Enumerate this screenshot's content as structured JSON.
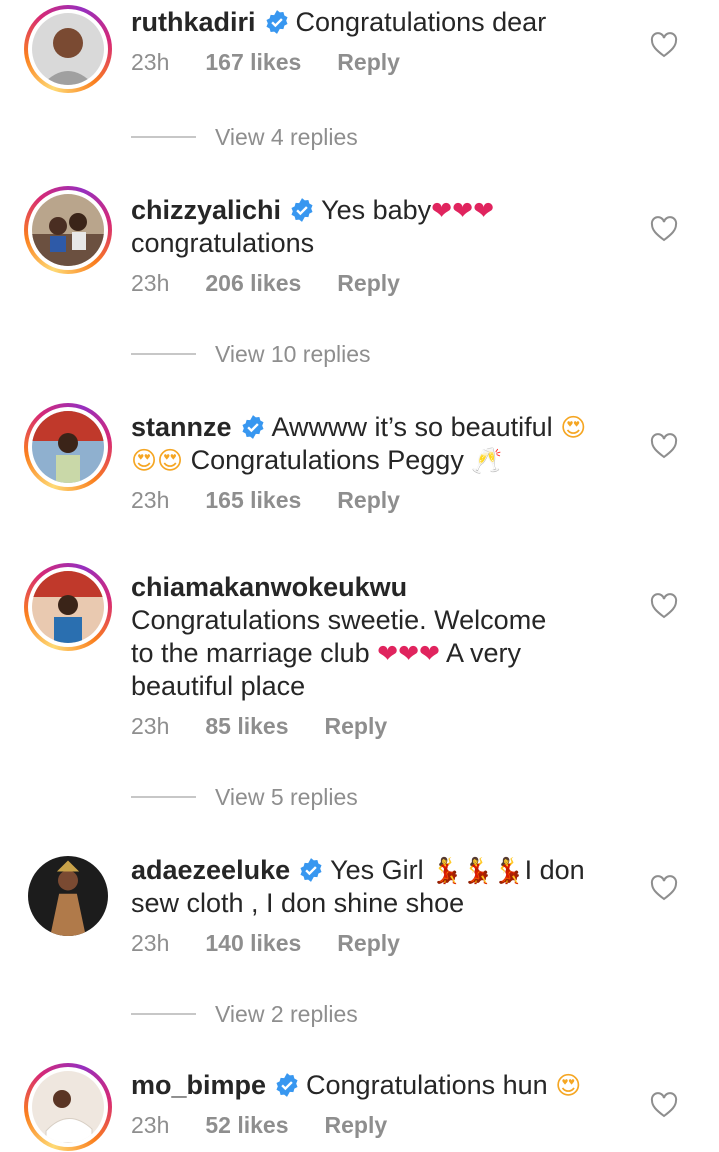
{
  "comments": [
    {
      "username": "ruthkadiri",
      "verified": true,
      "text": "Congratulations dear",
      "time": "23h",
      "likes": "167 likes",
      "reply": "Reply",
      "avatar_story_ring": true
    },
    {
      "username": "chizzyalichi",
      "verified": true,
      "text_line1": "Yes baby",
      "emoji1": "❤❤❤",
      "text_line2": "congratulations",
      "time": "23h",
      "likes": "206 likes",
      "reply": "Reply",
      "avatar_story_ring": true
    },
    {
      "username": "stannze",
      "verified": true,
      "text_line1": "Awwww it’s so beautiful",
      "emoji1": "😍",
      "emoji2": "😍😍",
      "text_line2": "Congratulations Peggy",
      "emoji3": "🥂",
      "time": "23h",
      "likes": "165 likes",
      "reply": "Reply",
      "avatar_story_ring": true
    },
    {
      "username": "chiamakanwokeukwu",
      "verified": false,
      "text_line1": "Congratulations sweetie. Welcome",
      "text_line2": "to the marriage club",
      "emoji1": "❤❤❤",
      "text_line2b": "A very",
      "text_line3": "beautiful place",
      "time": "23h",
      "likes": "85 likes",
      "reply": "Reply",
      "avatar_story_ring": true
    },
    {
      "username": "adaezeeluke",
      "verified": true,
      "text_line1": "Yes Girl",
      "emoji1": "💃💃💃",
      "text_line1b": "I don",
      "text_line2": "sew cloth , I don shine shoe",
      "time": "23h",
      "likes": "140 likes",
      "reply": "Reply",
      "avatar_story_ring": false
    },
    {
      "username": "mo_bimpe",
      "verified": true,
      "text": "Congratulations hun",
      "emoji1": "😍",
      "time": "23h",
      "likes": "52 likes",
      "reply": "Reply",
      "avatar_story_ring": true
    }
  ],
  "view_replies": [
    "View 4 replies",
    "View 10 replies",
    "View 5 replies",
    "View 2 replies"
  ],
  "colors": {
    "text": "#262626",
    "muted": "#8e8e8e",
    "verified_blue": "#3897f0",
    "ring_start": "#feda75",
    "ring_end": "#962fbf"
  },
  "icons": {
    "verified": "verified-badge-icon",
    "like": "heart-outline-icon"
  }
}
